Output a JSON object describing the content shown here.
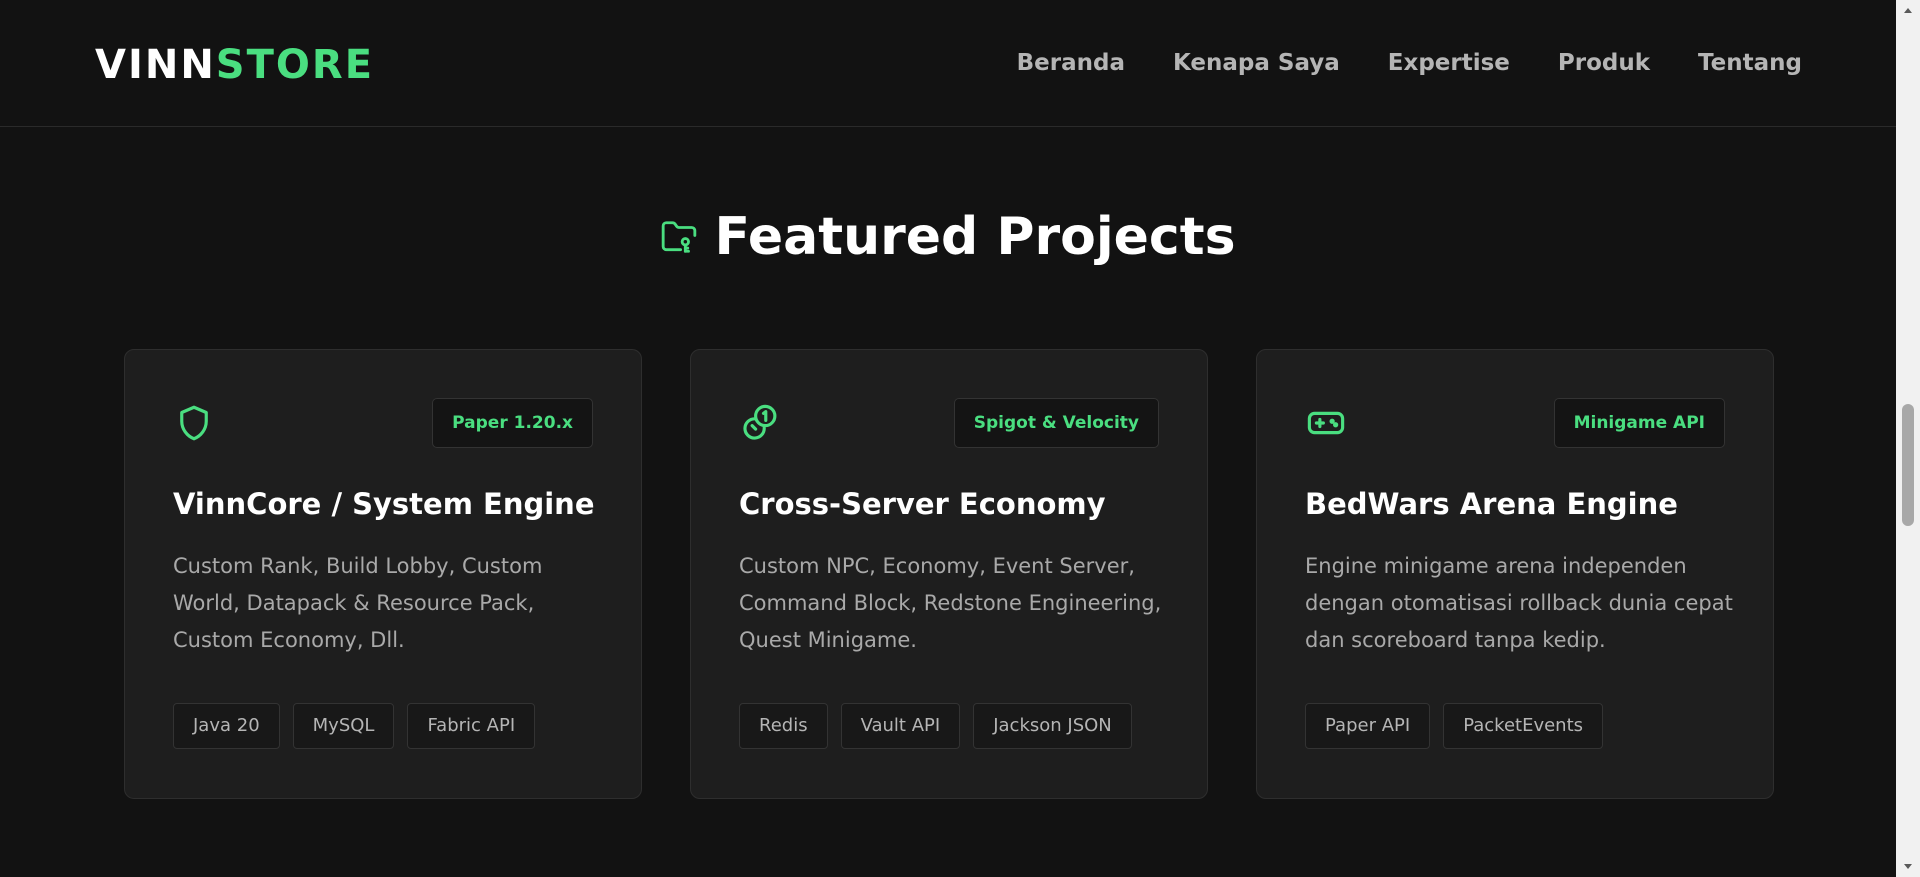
{
  "brand": {
    "part1": "VINN",
    "part2": "STORE",
    "accent_color": "#4ade80"
  },
  "nav": {
    "items": [
      {
        "label": "Beranda"
      },
      {
        "label": "Kenapa Saya"
      },
      {
        "label": "Expertise"
      },
      {
        "label": "Produk"
      },
      {
        "label": "Tentang"
      }
    ]
  },
  "section": {
    "icon": "folder-key-icon",
    "title": "Featured Projects"
  },
  "cards": [
    {
      "icon": "shield-icon",
      "badge": "Paper 1.20.x",
      "title": "VinnCore / System Engine",
      "description": "Custom Rank, Build Lobby, Custom World, Datapack & Resource Pack, Custom Economy, Dll.",
      "tags": [
        "Java 20",
        "MySQL",
        "Fabric API"
      ]
    },
    {
      "icon": "coins-icon",
      "badge": "Spigot & Velocity",
      "title": "Cross-Server Economy",
      "description": "Custom NPC, Economy, Event Server, Command Block, Redstone Engineering, Quest Minigame.",
      "tags": [
        "Redis",
        "Vault API",
        "Jackson JSON"
      ]
    },
    {
      "icon": "gamepad-icon",
      "badge": "Minigame API",
      "title": "BedWars Arena Engine",
      "description": "Engine minigame arena independen dengan otomatisasi rollback dunia cepat dan scoreboard tanpa kedip.",
      "tags": [
        "Paper API",
        "PacketEvents"
      ]
    }
  ]
}
